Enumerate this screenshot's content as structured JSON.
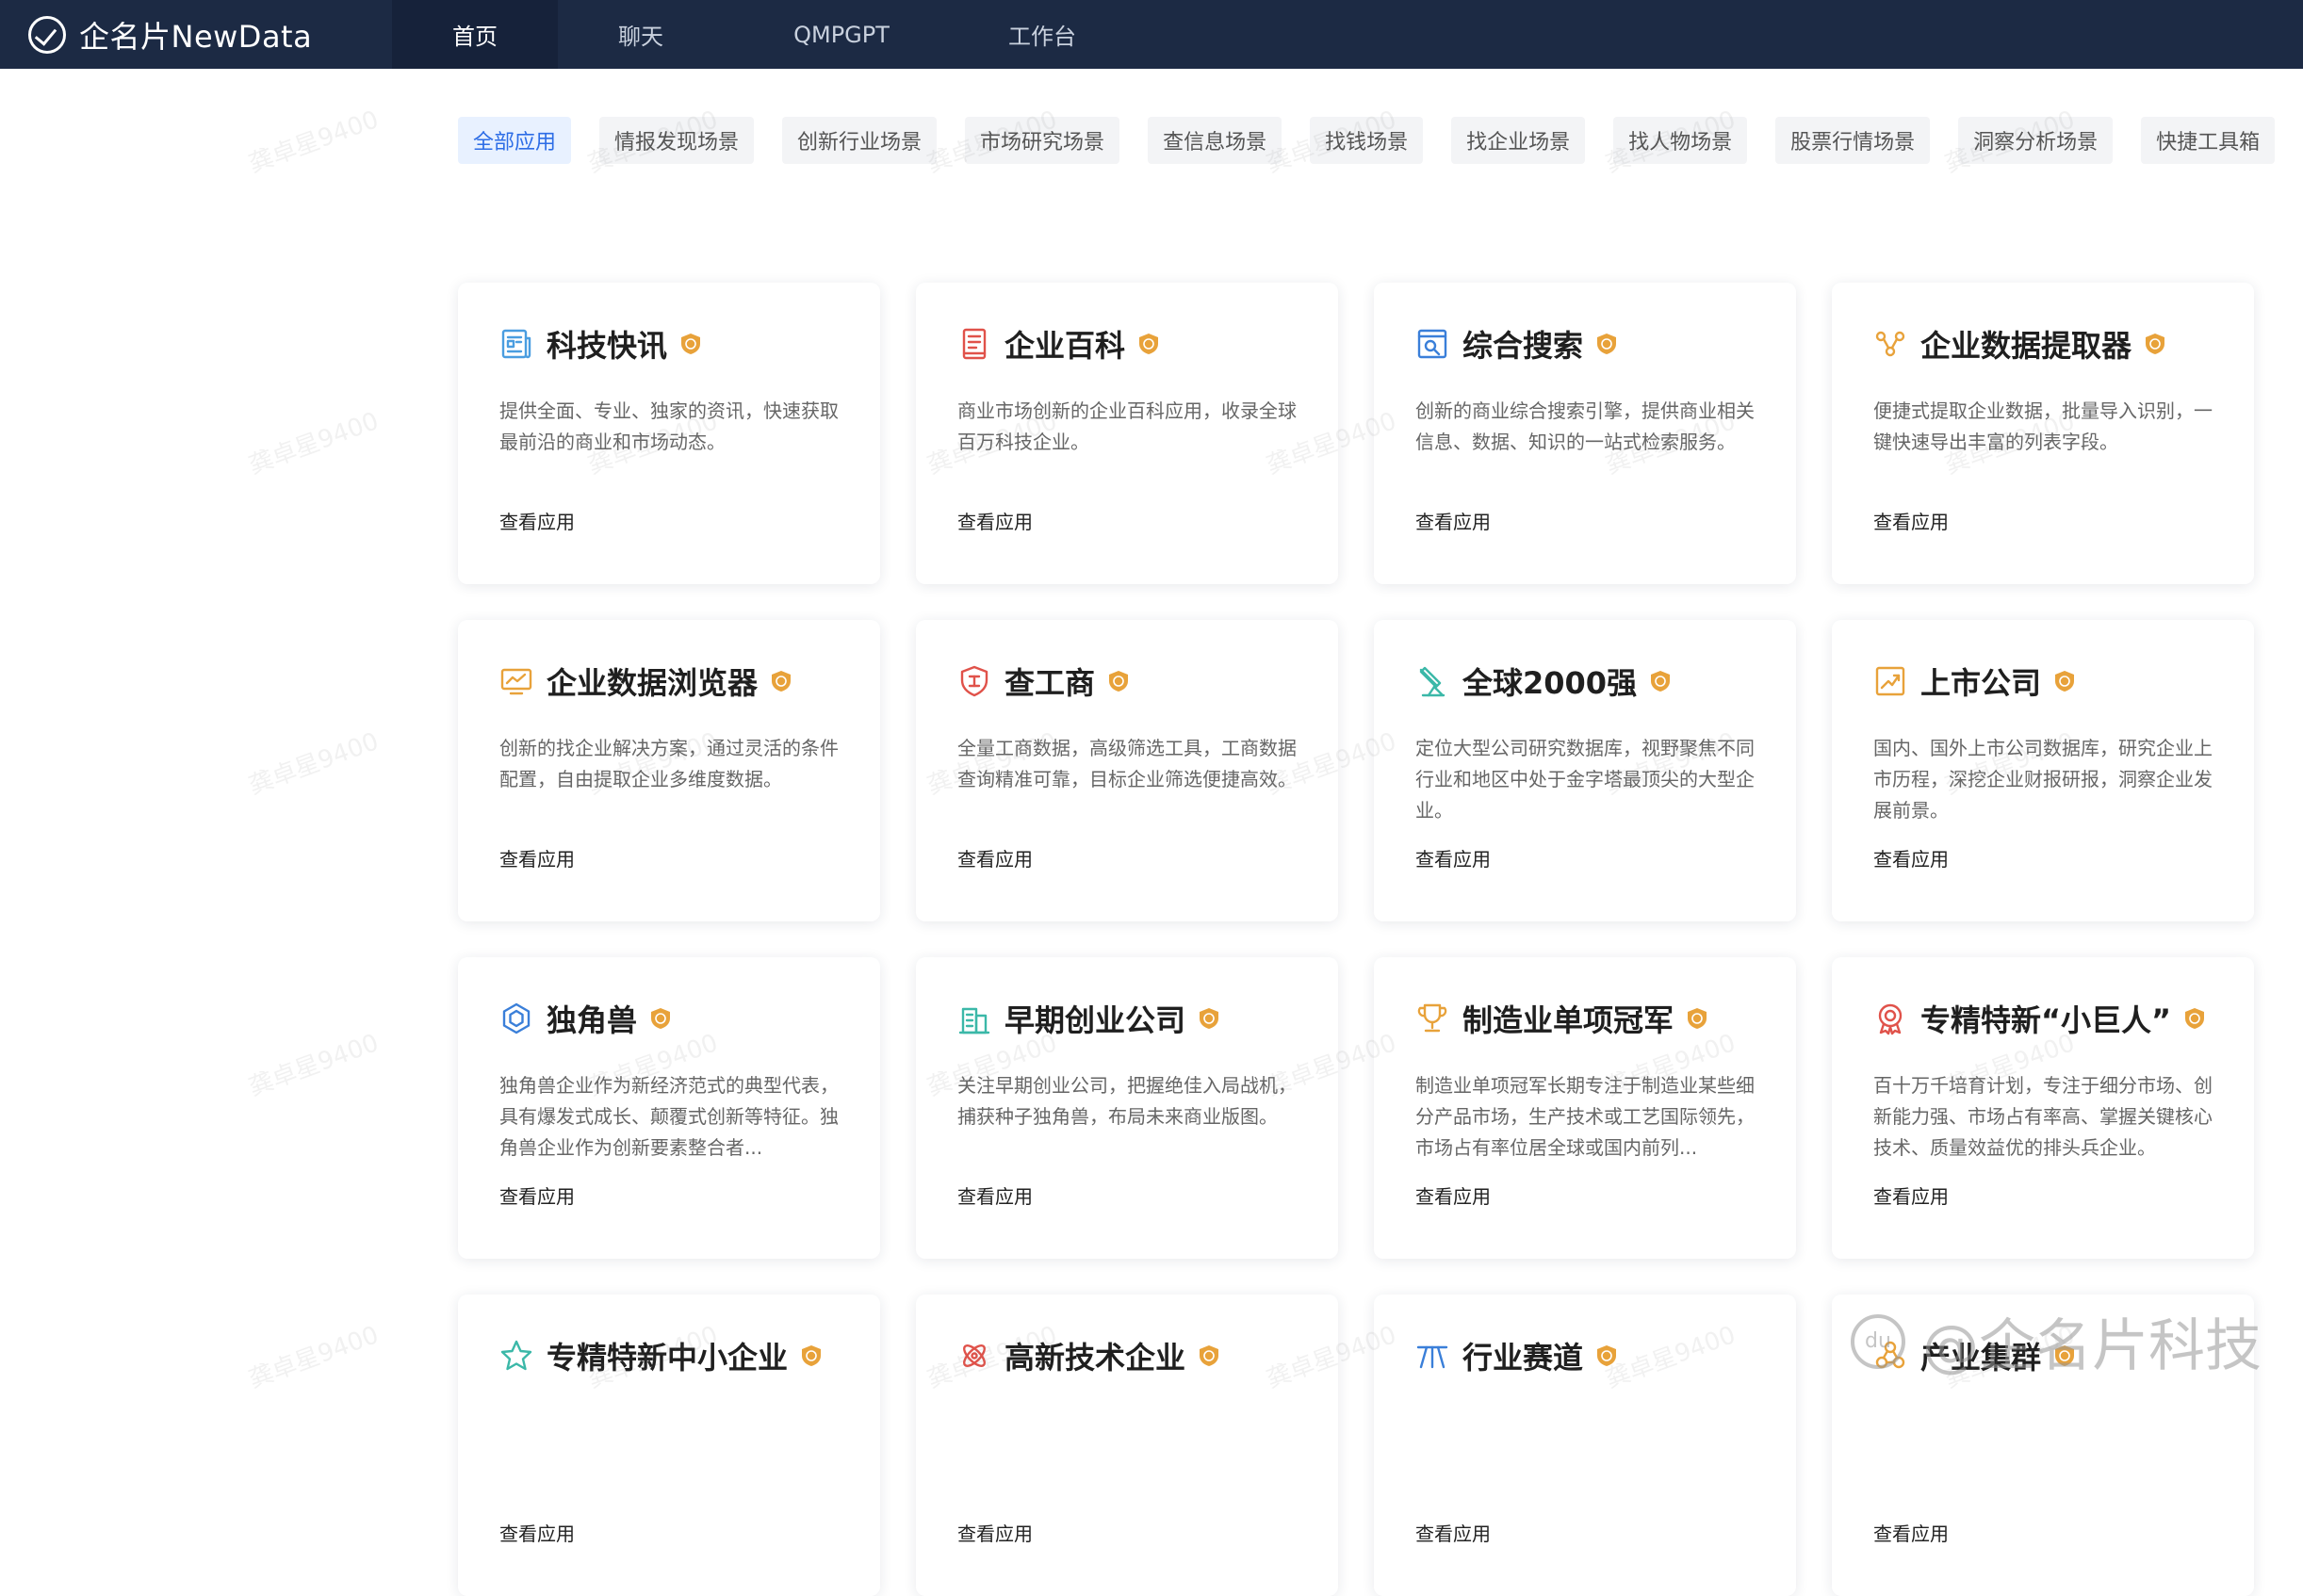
{
  "app": {
    "brand": "企名片NewData"
  },
  "nav": [
    {
      "label": "首页",
      "active": true
    },
    {
      "label": "聊天",
      "active": false
    },
    {
      "label": "QMPGPT",
      "active": false
    },
    {
      "label": "工作台",
      "active": false
    }
  ],
  "categories": [
    {
      "label": "全部应用",
      "active": true
    },
    {
      "label": "情报发现场景",
      "active": false
    },
    {
      "label": "创新行业场景",
      "active": false
    },
    {
      "label": "市场研究场景",
      "active": false
    },
    {
      "label": "查信息场景",
      "active": false
    },
    {
      "label": "找钱场景",
      "active": false
    },
    {
      "label": "找企业场景",
      "active": false
    },
    {
      "label": "找人物场景",
      "active": false
    },
    {
      "label": "股票行情场景",
      "active": false
    },
    {
      "label": "洞察分析场景",
      "active": false
    },
    {
      "label": "快捷工具箱",
      "active": false
    }
  ],
  "view_label": "查看应用",
  "apps": [
    {
      "title": "科技快讯",
      "icon": "newspaper-icon",
      "color": "#4a9de0",
      "desc": "提供全面、专业、独家的资讯，快速获取最前沿的商业和市场动态。"
    },
    {
      "title": "企业百科",
      "icon": "book-icon",
      "color": "#e0524a",
      "desc": "商业市场创新的企业百科应用，收录全球百万科技企业。"
    },
    {
      "title": "综合搜索",
      "icon": "search-doc-icon",
      "color": "#3a7fd9",
      "desc": "创新的商业综合搜索引擎，提供商业相关信息、数据、知识的一站式检索服务。"
    },
    {
      "title": "企业数据提取器",
      "icon": "nodes-icon",
      "color": "#e8a23a",
      "desc": "便捷式提取企业数据，批量导入识别，一键快速导出丰富的列表字段。"
    },
    {
      "title": "企业数据浏览器",
      "icon": "monitor-icon",
      "color": "#e8a23a",
      "desc": "创新的找企业解决方案，通过灵活的条件配置，自由提取企业多维度数据。"
    },
    {
      "title": "查工商",
      "icon": "shield-icon",
      "color": "#e0524a",
      "desc": "全量工商数据，高级筛选工具，工商数据查询精准可靠，目标企业筛选便捷高效。"
    },
    {
      "title": "全球2000强",
      "icon": "telescope-icon",
      "color": "#3bb8a8",
      "desc": "定位大型公司研究数据库，视野聚焦不同行业和地区中处于金字塔最顶尖的大型企业。"
    },
    {
      "title": "上市公司",
      "icon": "chart-up-icon",
      "color": "#e8a23a",
      "desc": "国内、国外上市公司数据库，研究企业上市历程，深挖企业财报研报，洞察企业发展前景。"
    },
    {
      "title": "独角兽",
      "icon": "hexagon-icon",
      "color": "#3a7fd9",
      "desc": "独角兽企业作为新经济范式的典型代表，具有爆发式成长、颠覆式创新等特征。独角兽企业作为创新要素整合者..."
    },
    {
      "title": "早期创业公司",
      "icon": "building-icon",
      "color": "#3bb8a8",
      "desc": "关注早期创业公司，把握绝佳入局战机，捕获种子独角兽，布局未来商业版图。"
    },
    {
      "title": "制造业单项冠军",
      "icon": "trophy-icon",
      "color": "#e8a23a",
      "desc": "制造业单项冠军长期专注于制造业某些细分产品市场，生产技术或工艺国际领先，市场占有率位居全球或国内前列..."
    },
    {
      "title": "专精特新“小巨人”",
      "icon": "medal-icon",
      "color": "#e0524a",
      "desc": "百十万千培育计划，专注于细分市场、创新能力强、市场占有率高、掌握关键核心技术、质量效益优的排头兵企业。"
    },
    {
      "title": "专精特新中小企业",
      "icon": "star-icon",
      "color": "#3bb8a8",
      "desc": ""
    },
    {
      "title": "高新技术企业",
      "icon": "atom-icon",
      "color": "#e0524a",
      "desc": ""
    },
    {
      "title": "行业赛道",
      "icon": "track-icon",
      "color": "#3a7fd9",
      "desc": ""
    },
    {
      "title": "产业集群",
      "icon": "cluster-icon",
      "color": "#e8a23a",
      "desc": ""
    }
  ],
  "watermark": {
    "text": "龚卓星9400",
    "corner_text": "@企名片科技",
    "corner_logo": "du"
  }
}
